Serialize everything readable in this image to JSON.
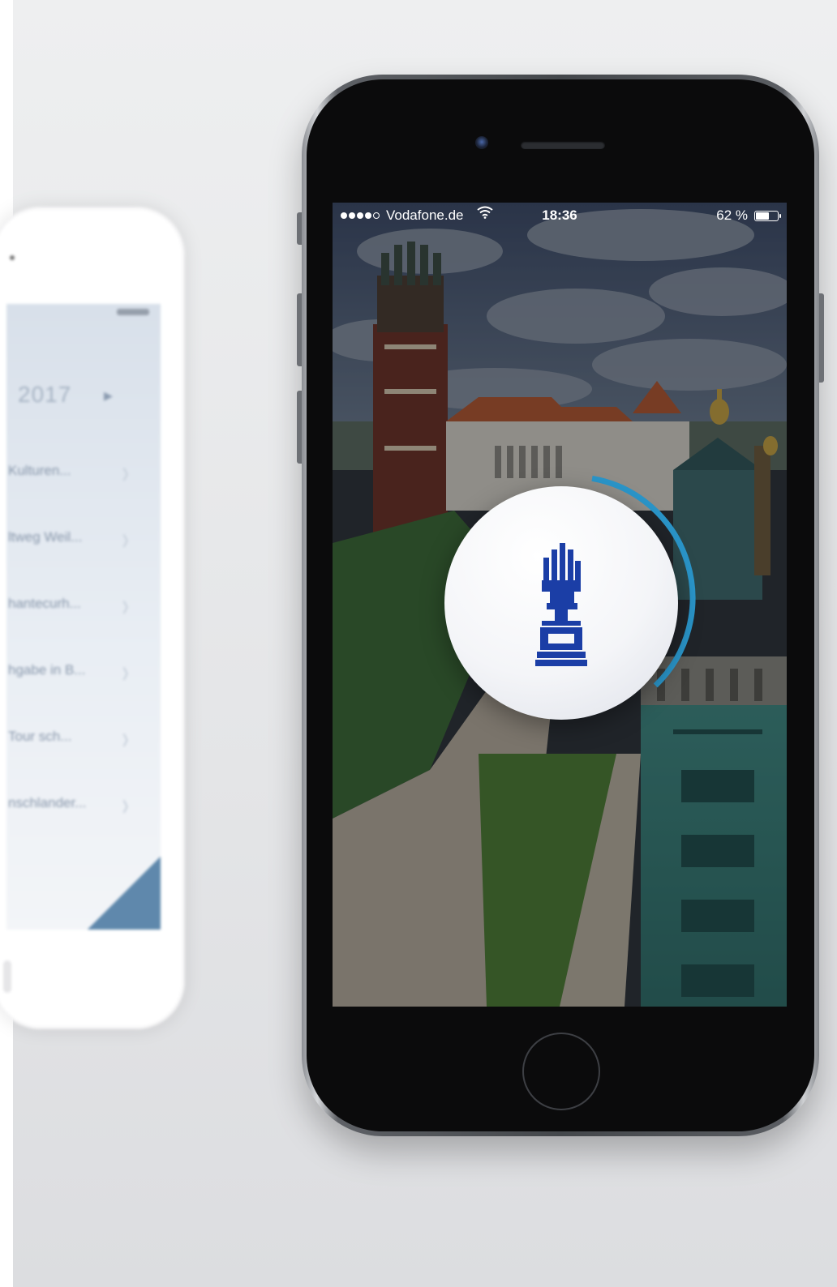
{
  "status_bar": {
    "carrier": "Vodafone.de",
    "time": "18:36",
    "battery_percent_label": "62 %",
    "battery_level": 0.62,
    "signal_bars_filled": 4,
    "signal_bars_total": 5
  },
  "splash": {
    "loading_progress": 0.35,
    "accent_color": "#2a95c9",
    "logo_color": "#1b3ea6",
    "logo_icon": "hand-arm-logo-icon"
  },
  "background_phone": {
    "year_label": "2017",
    "list_items": [
      "Kulturen...",
      "ltweg Weil...",
      "hantecurh...",
      "hgabe in B...",
      "Tour sch...",
      "nschlander..."
    ]
  }
}
